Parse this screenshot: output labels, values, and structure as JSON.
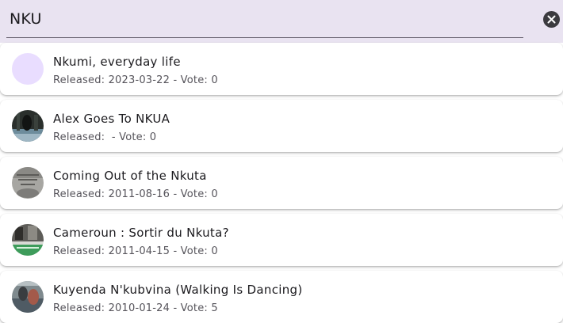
{
  "search": {
    "query": "NKU"
  },
  "icons": {
    "clear": "close-circle-icon"
  },
  "colors": {
    "search_bar_bg": "#e9e3f1",
    "placeholder_avatar": "#e9ddff"
  },
  "results": [
    {
      "title": "Nkumi, everyday life",
      "released_label": "Released: ",
      "released": "2023-03-22",
      "vote_label": " - Vote: ",
      "vote": "0",
      "avatar": "placeholder"
    },
    {
      "title": "Alex Goes To NKUA",
      "released_label": "Released: ",
      "released": "",
      "vote_label": " - Vote: ",
      "vote": "0",
      "avatar": "poster"
    },
    {
      "title": "Coming Out of the Nkuta",
      "released_label": "Released: ",
      "released": "2011-08-16",
      "vote_label": " - Vote: ",
      "vote": "0",
      "avatar": "poster"
    },
    {
      "title": "Cameroun : Sortir du Nkuta?",
      "released_label": "Released: ",
      "released": "2011-04-15",
      "vote_label": " - Vote: ",
      "vote": "0",
      "avatar": "poster"
    },
    {
      "title": "Kuyenda N'kubvina (Walking Is Dancing)",
      "released_label": "Released: ",
      "released": "2010-01-24",
      "vote_label": " - Vote: ",
      "vote": "5",
      "avatar": "poster"
    }
  ]
}
